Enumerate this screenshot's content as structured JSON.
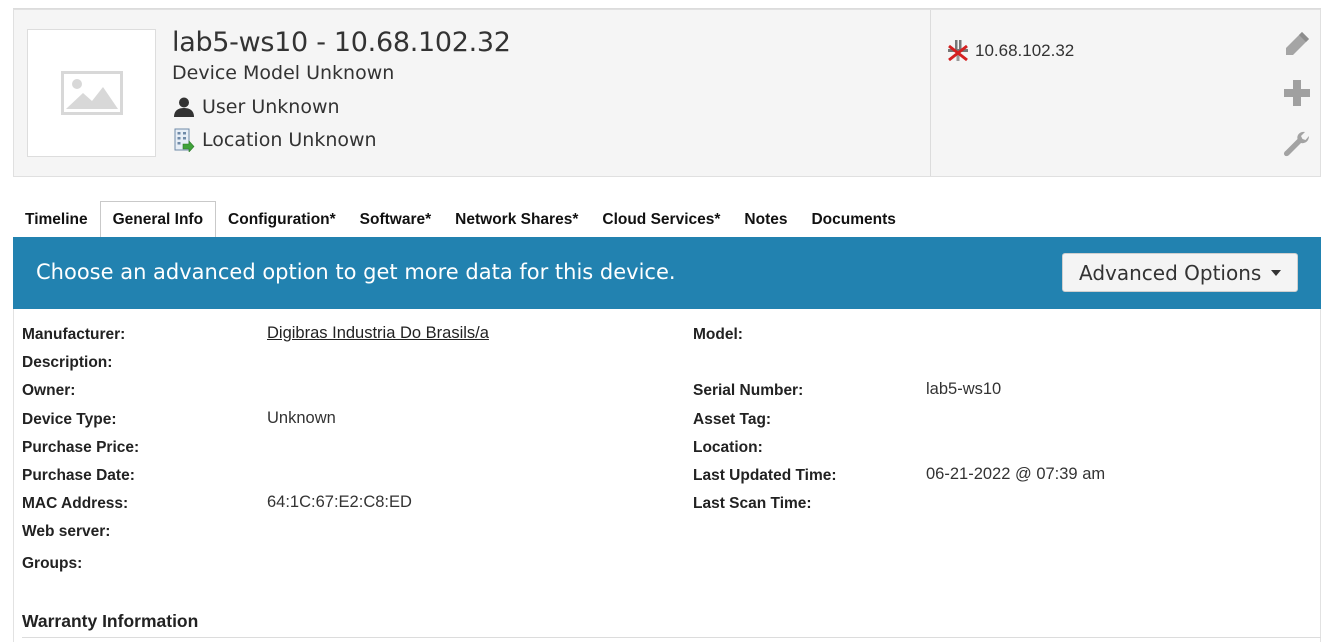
{
  "device": {
    "title": "lab5-ws10 - 10.68.102.32",
    "model": "Device Model Unknown",
    "user": "User Unknown",
    "location": "Location Unknown",
    "ip": "10.68.102.32"
  },
  "tabs": [
    {
      "label": "Timeline",
      "active": false
    },
    {
      "label": "General Info",
      "active": true
    },
    {
      "label": "Configuration*",
      "active": false
    },
    {
      "label": "Software*",
      "active": false
    },
    {
      "label": "Network Shares*",
      "active": false
    },
    {
      "label": "Cloud Services*",
      "active": false
    },
    {
      "label": "Notes",
      "active": false
    },
    {
      "label": "Documents",
      "active": false
    }
  ],
  "banner": {
    "text": "Choose an advanced option to get more data for this device.",
    "button_label": "Advanced Options"
  },
  "info_left": [
    {
      "label": "Manufacturer:",
      "value": "Digibras Industria Do Brasils/a",
      "link": true
    },
    {
      "label": "Description:",
      "value": ""
    },
    {
      "label": "Owner:",
      "value": ""
    },
    {
      "label": "Device Type:",
      "value": "Unknown"
    },
    {
      "label": "Purchase Price:",
      "value": ""
    },
    {
      "label": "Purchase Date:",
      "value": ""
    },
    {
      "label": "MAC Address:",
      "value": "64:1C:67:E2:C8:ED"
    },
    {
      "label": "Web server:",
      "value": ""
    },
    {
      "label": "Groups:",
      "value": ""
    }
  ],
  "info_right": [
    {
      "label": "Model:",
      "value": ""
    },
    {
      "label": "Serial Number:",
      "value": "lab5-ws10"
    },
    {
      "label": "Asset Tag:",
      "value": ""
    },
    {
      "label": "Location:",
      "value": ""
    },
    {
      "label": "Last Updated Time:",
      "value": "06-21-2022 @ 07:39 am"
    },
    {
      "label": "Last Scan Time:",
      "value": ""
    }
  ],
  "warranty_heading": "Warranty Information",
  "colors": {
    "banner": "#2282b0",
    "header_bg": "#f5f5f5",
    "icon_gray": "#9a9a9a"
  }
}
